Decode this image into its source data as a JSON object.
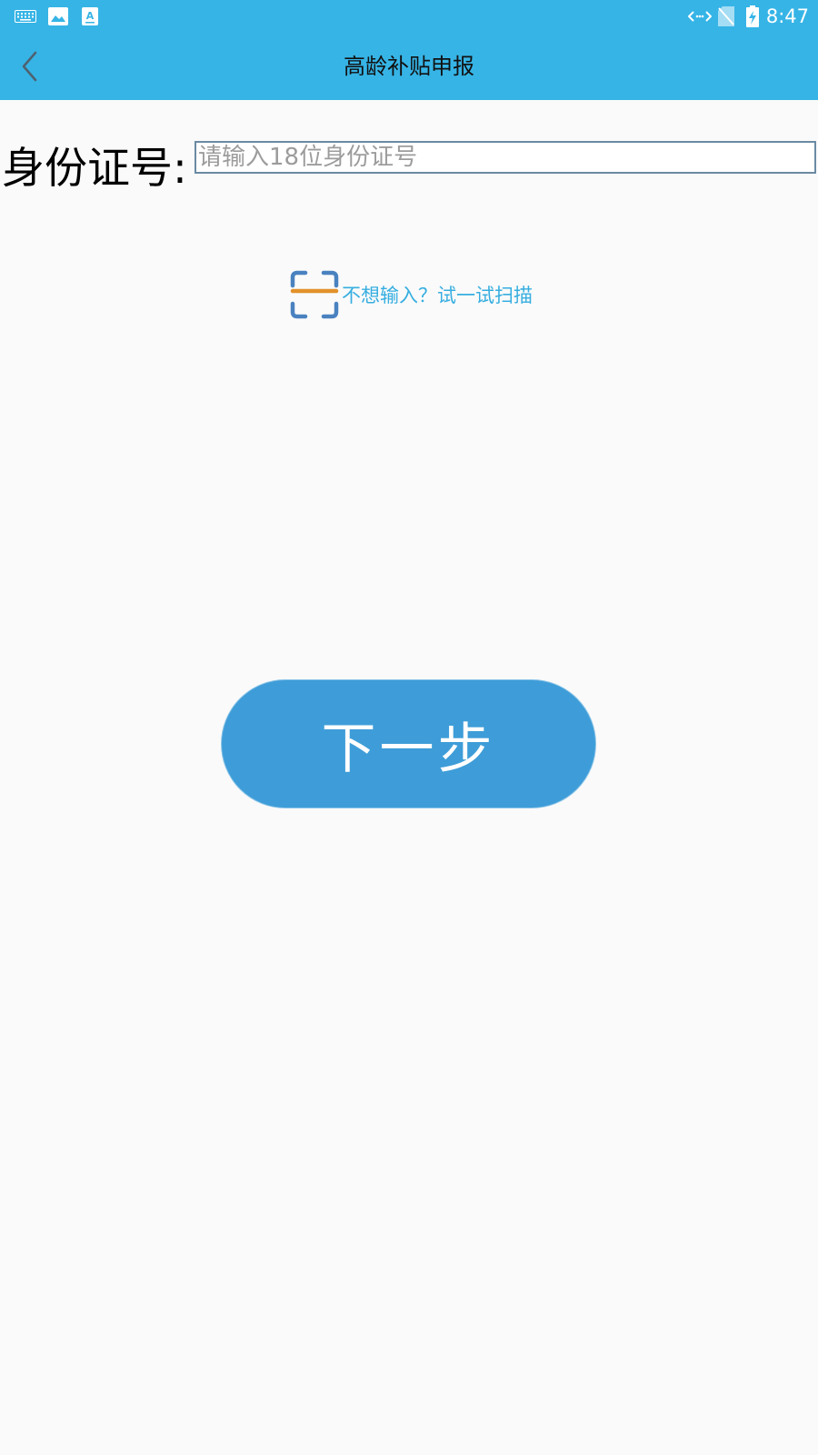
{
  "status_bar": {
    "time": "8:47",
    "left_icons": [
      "keyboard-icon",
      "image-icon",
      "text-app-icon"
    ],
    "right_icons": [
      "data-transfer-icon",
      "no-sim-icon",
      "battery-charging-icon"
    ]
  },
  "app_bar": {
    "title": "高龄补贴申报",
    "back_icon": "chevron-left-icon",
    "background_color": "#36b4e6"
  },
  "form": {
    "id_label": "身份证号:",
    "id_input_placeholder": "请输入18位身份证号",
    "id_input_value": ""
  },
  "scan": {
    "icon": "scan-icon",
    "text": "不想输入？试一试扫描",
    "text_color": "#36aee0"
  },
  "next_button": {
    "label": "下一步",
    "color": "#3e9dd8"
  }
}
